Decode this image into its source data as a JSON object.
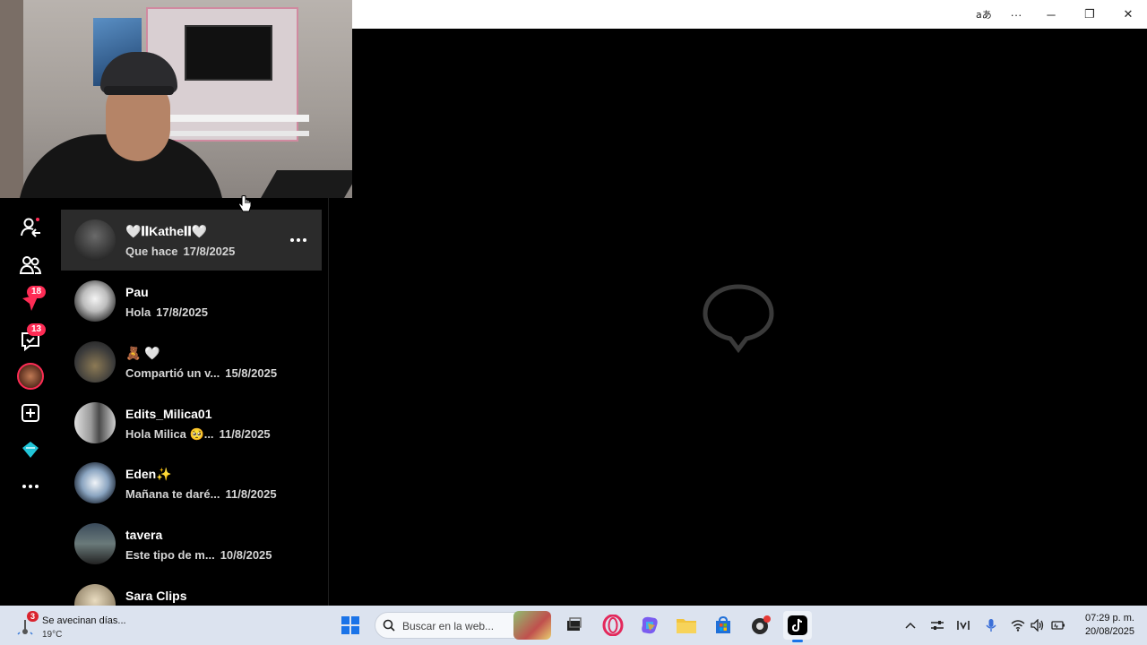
{
  "titlebar": {
    "translate_icon": "translate-icon",
    "more_label": "···",
    "minimize_label": "─",
    "restore_label": "❐",
    "close_label": "✕"
  },
  "nav": {
    "items": [
      {
        "icon": "following-icon"
      },
      {
        "icon": "friends-icon"
      },
      {
        "icon": "activity-icon",
        "badge": "18"
      },
      {
        "icon": "messages-icon",
        "badge": "13"
      },
      {
        "icon": "live-avatar-icon"
      },
      {
        "icon": "upload-icon"
      },
      {
        "icon": "coins-icon"
      },
      {
        "icon": "more-icon"
      }
    ]
  },
  "conversations": [
    {
      "name": "🤍𝐈𝐈Kathe𝐈𝐈🤍",
      "preview": "Que hace",
      "date": "17/8/2025",
      "active": true
    },
    {
      "name": "Pau",
      "preview": "Hola",
      "date": "17/8/2025"
    },
    {
      "name": "🧸 🤍",
      "preview": "Compartió un v...",
      "date": "15/8/2025"
    },
    {
      "name": "Edits_Milica01",
      "preview": "Hola Milica 🥺...",
      "date": "11/8/2025"
    },
    {
      "name": "Eden✨",
      "preview": "Mañana te daré...",
      "date": "11/8/2025"
    },
    {
      "name": "tavera",
      "preview": "Este tipo de m...",
      "date": "10/8/2025"
    },
    {
      "name": "Sara Clips",
      "preview": "",
      "date": ""
    }
  ],
  "taskbar": {
    "weather": {
      "text": "Se avecinan días...",
      "temp": "19°C",
      "badge": "3"
    },
    "search_placeholder": "Buscar en la web...",
    "clock_time": "07:29 p. m.",
    "clock_date": "20/08/2025"
  },
  "colors": {
    "accent": "#fe2c55",
    "active_row": "#2b2b2b",
    "taskbar": "#dce3ef"
  }
}
